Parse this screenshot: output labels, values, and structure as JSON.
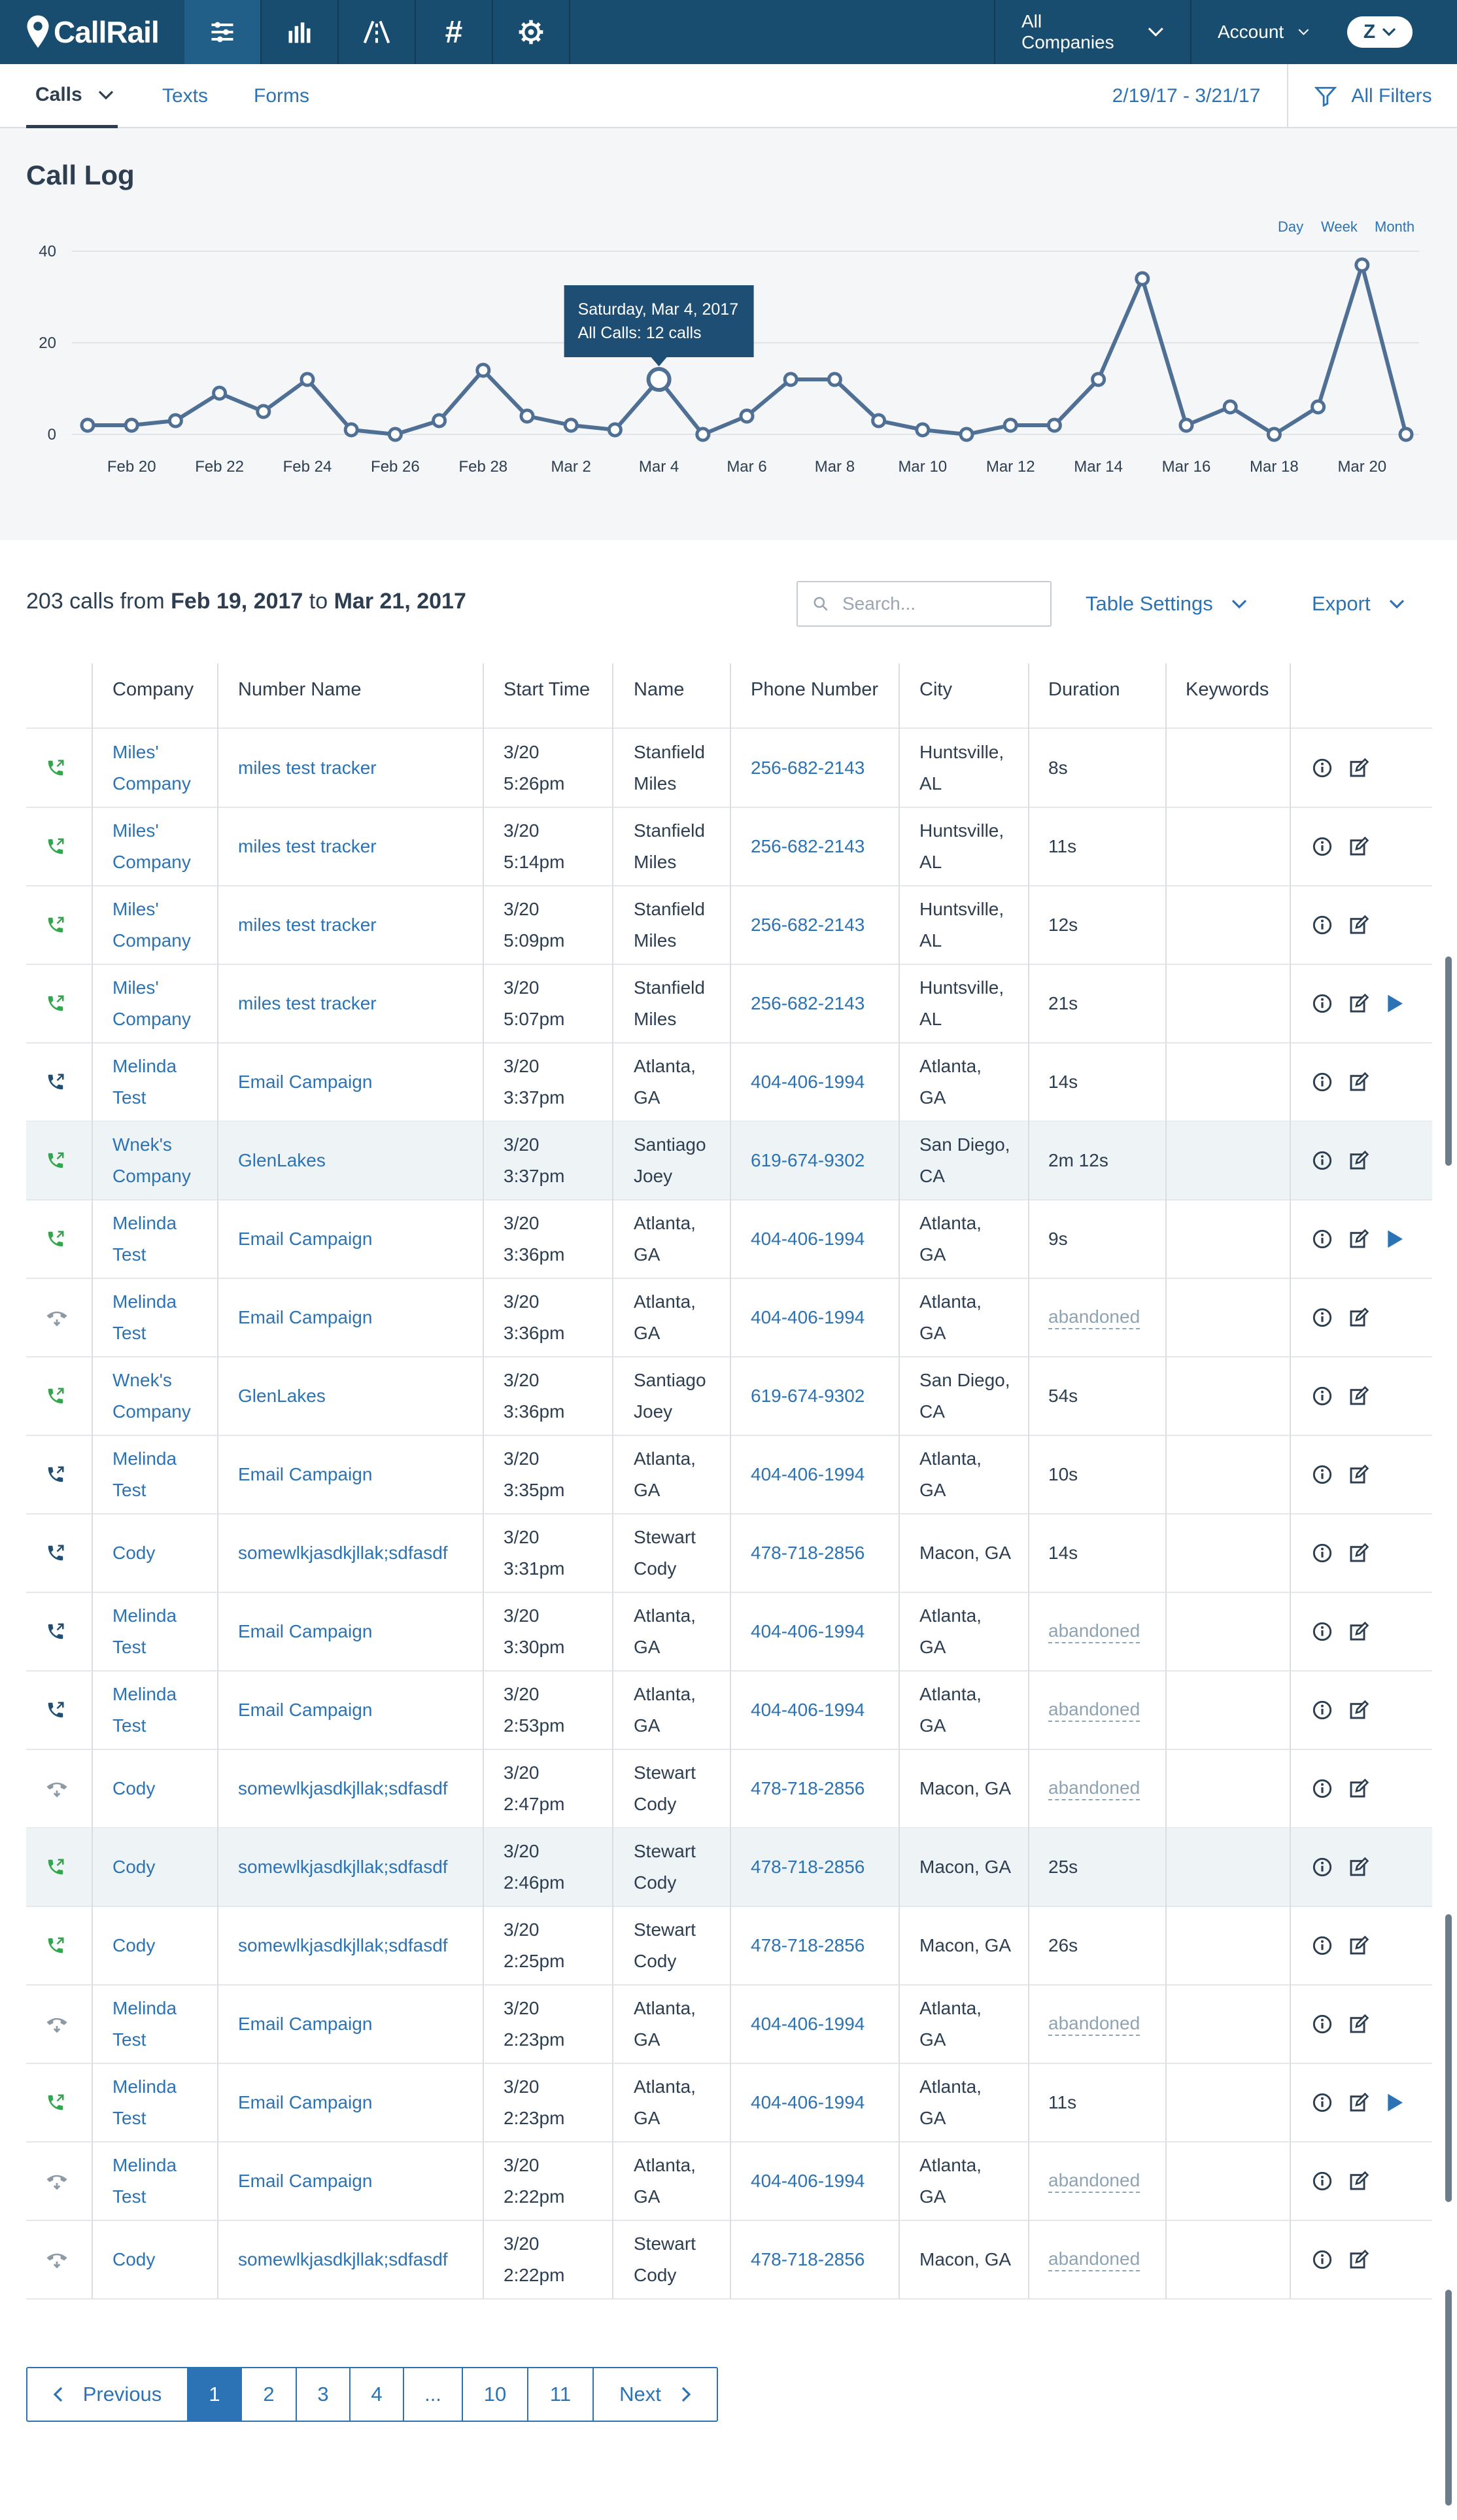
{
  "app": {
    "logo_text": "CallRail"
  },
  "topnav": {
    "icons": [
      "activity-feed-icon",
      "reports-bar-chart-icon",
      "routing-icon",
      "tracking-hash-icon",
      "settings-gear-icon"
    ],
    "companies_label": "All Companies",
    "account_label": "Account",
    "avatar_letter": "Z"
  },
  "subnav": {
    "tabs": [
      {
        "label": "Calls"
      },
      {
        "label": "Texts"
      },
      {
        "label": "Forms"
      }
    ],
    "date_range": "2/19/17 - 3/21/17",
    "filters_label": "All Filters"
  },
  "call_log": {
    "title": "Call Log",
    "granularity": [
      "Day",
      "Week",
      "Month"
    ],
    "tooltip": {
      "line1": "Saturday, Mar 4, 2017",
      "line2": "All Calls: 12 calls"
    }
  },
  "chart_data": {
    "type": "line",
    "title": "Call Log",
    "ylim": [
      0,
      40
    ],
    "yticks": [
      "0",
      "20",
      "40"
    ],
    "xticks": [
      "Feb 20",
      "Feb 22",
      "Feb 24",
      "Feb 26",
      "Feb 28",
      "Mar 2",
      "Mar 4",
      "Mar 6",
      "Mar 8",
      "Mar 10",
      "Mar 12",
      "Mar 14",
      "Mar 16",
      "Mar 18",
      "Mar 20"
    ],
    "x": [
      "Feb 19",
      "Feb 20",
      "Feb 21",
      "Feb 22",
      "Feb 23",
      "Feb 24",
      "Feb 25",
      "Feb 26",
      "Feb 27",
      "Feb 28",
      "Mar 1",
      "Mar 2",
      "Mar 3",
      "Mar 4",
      "Mar 5",
      "Mar 6",
      "Mar 7",
      "Mar 8",
      "Mar 9",
      "Mar 10",
      "Mar 11",
      "Mar 12",
      "Mar 13",
      "Mar 14",
      "Mar 15",
      "Mar 16",
      "Mar 17",
      "Mar 18",
      "Mar 19",
      "Mar 20",
      "Mar 21"
    ],
    "series": [
      {
        "name": "All Calls",
        "values": [
          2,
          2,
          3,
          9,
          5,
          12,
          1,
          0,
          3,
          14,
          4,
          2,
          1,
          12,
          0,
          4,
          12,
          12,
          3,
          1,
          0,
          2,
          2,
          12,
          34,
          2,
          6,
          0,
          6,
          37,
          0
        ]
      }
    ],
    "highlight": "Mar 4",
    "grid": true,
    "color": "#4f6f94"
  },
  "table": {
    "summary": {
      "prefix": "203 calls from ",
      "from": "Feb 19, 2017",
      "mid": " to ",
      "to": "Mar 21, 2017"
    },
    "search_placeholder": "Search...",
    "table_settings_label": "Table Settings",
    "export_label": "Export",
    "columns": [
      "Company",
      "Number Name",
      "Start Time",
      "Name",
      "Phone Number",
      "City",
      "Duration",
      "Keywords"
    ],
    "rows": [
      {
        "status": "answered",
        "company": [
          "Miles'",
          "Company"
        ],
        "number_name": "miles test tracker",
        "start": [
          "3/20",
          "5:26pm"
        ],
        "name": [
          "Stanfield",
          "Miles"
        ],
        "phone": "256-682-2143",
        "city": [
          "Huntsville,",
          "AL"
        ],
        "duration": "8s",
        "recording": false
      },
      {
        "status": "answered",
        "company": [
          "Miles'",
          "Company"
        ],
        "number_name": "miles test tracker",
        "start": [
          "3/20",
          "5:14pm"
        ],
        "name": [
          "Stanfield",
          "Miles"
        ],
        "phone": "256-682-2143",
        "city": [
          "Huntsville,",
          "AL"
        ],
        "duration": "11s",
        "recording": false
      },
      {
        "status": "answered",
        "company": [
          "Miles'",
          "Company"
        ],
        "number_name": "miles test tracker",
        "start": [
          "3/20",
          "5:09pm"
        ],
        "name": [
          "Stanfield",
          "Miles"
        ],
        "phone": "256-682-2143",
        "city": [
          "Huntsville,",
          "AL"
        ],
        "duration": "12s",
        "recording": false
      },
      {
        "status": "answered",
        "company": [
          "Miles'",
          "Company"
        ],
        "number_name": "miles test tracker",
        "start": [
          "3/20",
          "5:07pm"
        ],
        "name": [
          "Stanfield",
          "Miles"
        ],
        "phone": "256-682-2143",
        "city": [
          "Huntsville,",
          "AL"
        ],
        "duration": "21s",
        "recording": true
      },
      {
        "status": "outbound",
        "company": [
          "Melinda",
          "Test"
        ],
        "number_name": "Email Campaign",
        "start": [
          "3/20",
          "3:37pm"
        ],
        "name": [
          "Atlanta,",
          "GA"
        ],
        "phone": "404-406-1994",
        "city": [
          "Atlanta,",
          "GA"
        ],
        "duration": "14s",
        "recording": false
      },
      {
        "status": "answered",
        "highlight": true,
        "company": [
          "Wnek's",
          "Company"
        ],
        "number_name": "GlenLakes",
        "start": [
          "3/20",
          "3:37pm"
        ],
        "name": [
          "Santiago",
          "Joey"
        ],
        "phone": "619-674-9302",
        "city": [
          "San Diego,",
          "CA"
        ],
        "duration": "2m 12s",
        "recording": false
      },
      {
        "status": "answered",
        "company": [
          "Melinda",
          "Test"
        ],
        "number_name": "Email Campaign",
        "start": [
          "3/20",
          "3:36pm"
        ],
        "name": [
          "Atlanta,",
          "GA"
        ],
        "phone": "404-406-1994",
        "city": [
          "Atlanta,",
          "GA"
        ],
        "duration": "9s",
        "recording": true
      },
      {
        "status": "abandoned",
        "company": [
          "Melinda",
          "Test"
        ],
        "number_name": "Email Campaign",
        "start": [
          "3/20",
          "3:36pm"
        ],
        "name": [
          "Atlanta,",
          "GA"
        ],
        "phone": "404-406-1994",
        "city": [
          "Atlanta,",
          "GA"
        ],
        "duration": "abandoned",
        "recording": false
      },
      {
        "status": "answered",
        "company": [
          "Wnek's",
          "Company"
        ],
        "number_name": "GlenLakes",
        "start": [
          "3/20",
          "3:36pm"
        ],
        "name": [
          "Santiago",
          "Joey"
        ],
        "phone": "619-674-9302",
        "city": [
          "San Diego,",
          "CA"
        ],
        "duration": "54s",
        "recording": false
      },
      {
        "status": "outbound",
        "company": [
          "Melinda",
          "Test"
        ],
        "number_name": "Email Campaign",
        "start": [
          "3/20",
          "3:35pm"
        ],
        "name": [
          "Atlanta,",
          "GA"
        ],
        "phone": "404-406-1994",
        "city": [
          "Atlanta,",
          "GA"
        ],
        "duration": "10s",
        "recording": false
      },
      {
        "status": "outbound",
        "company": [
          "Cody"
        ],
        "number_name": "somewlkjasdkjllak;sdfasdf",
        "start": [
          "3/20",
          "3:31pm"
        ],
        "name": [
          "Stewart",
          "Cody"
        ],
        "phone": "478-718-2856",
        "city": [
          "Macon, GA"
        ],
        "duration": "14s",
        "recording": false
      },
      {
        "status": "outbound",
        "company": [
          "Melinda",
          "Test"
        ],
        "number_name": "Email Campaign",
        "start": [
          "3/20",
          "3:30pm"
        ],
        "name": [
          "Atlanta,",
          "GA"
        ],
        "phone": "404-406-1994",
        "city": [
          "Atlanta,",
          "GA"
        ],
        "duration": "abandoned",
        "recording": false
      },
      {
        "status": "outbound",
        "company": [
          "Melinda",
          "Test"
        ],
        "number_name": "Email Campaign",
        "start": [
          "3/20",
          "2:53pm"
        ],
        "name": [
          "Atlanta,",
          "GA"
        ],
        "phone": "404-406-1994",
        "city": [
          "Atlanta,",
          "GA"
        ],
        "duration": "abandoned",
        "recording": false
      },
      {
        "status": "abandoned",
        "company": [
          "Cody"
        ],
        "number_name": "somewlkjasdkjllak;sdfasdf",
        "start": [
          "3/20",
          "2:47pm"
        ],
        "name": [
          "Stewart",
          "Cody"
        ],
        "phone": "478-718-2856",
        "city": [
          "Macon, GA"
        ],
        "duration": "abandoned",
        "recording": false
      },
      {
        "status": "answered",
        "highlight": true,
        "company": [
          "Cody"
        ],
        "number_name": "somewlkjasdkjllak;sdfasdf",
        "start": [
          "3/20",
          "2:46pm"
        ],
        "name": [
          "Stewart",
          "Cody"
        ],
        "phone": "478-718-2856",
        "city": [
          "Macon, GA"
        ],
        "duration": "25s",
        "recording": false
      },
      {
        "status": "answered",
        "company": [
          "Cody"
        ],
        "number_name": "somewlkjasdkjllak;sdfasdf",
        "start": [
          "3/20",
          "2:25pm"
        ],
        "name": [
          "Stewart",
          "Cody"
        ],
        "phone": "478-718-2856",
        "city": [
          "Macon, GA"
        ],
        "duration": "26s",
        "recording": false
      },
      {
        "status": "abandoned",
        "company": [
          "Melinda",
          "Test"
        ],
        "number_name": "Email Campaign",
        "start": [
          "3/20",
          "2:23pm"
        ],
        "name": [
          "Atlanta,",
          "GA"
        ],
        "phone": "404-406-1994",
        "city": [
          "Atlanta,",
          "GA"
        ],
        "duration": "abandoned",
        "recording": false
      },
      {
        "status": "answered",
        "company": [
          "Melinda",
          "Test"
        ],
        "number_name": "Email Campaign",
        "start": [
          "3/20",
          "2:23pm"
        ],
        "name": [
          "Atlanta,",
          "GA"
        ],
        "phone": "404-406-1994",
        "city": [
          "Atlanta,",
          "GA"
        ],
        "duration": "11s",
        "recording": true
      },
      {
        "status": "abandoned",
        "company": [
          "Melinda",
          "Test"
        ],
        "number_name": "Email Campaign",
        "start": [
          "3/20",
          "2:22pm"
        ],
        "name": [
          "Atlanta,",
          "GA"
        ],
        "phone": "404-406-1994",
        "city": [
          "Atlanta,",
          "GA"
        ],
        "duration": "abandoned",
        "recording": false
      },
      {
        "status": "abandoned",
        "company": [
          "Cody"
        ],
        "number_name": "somewlkjasdkjllak;sdfasdf",
        "start": [
          "3/20",
          "2:22pm"
        ],
        "name": [
          "Stewart",
          "Cody"
        ],
        "phone": "478-718-2856",
        "city": [
          "Macon, GA"
        ],
        "duration": "abandoned",
        "recording": false
      }
    ]
  },
  "pagination": {
    "prev": "Previous",
    "pages": [
      "1",
      "2",
      "3",
      "4",
      "...",
      "10",
      "11"
    ],
    "current": "1",
    "next": "Next"
  },
  "colors": {
    "nav": "#184d70",
    "link": "#2b73b5",
    "answered": "#2ea84a",
    "outbound": "#1f4e74",
    "abandoned": "#8c9aa6"
  }
}
